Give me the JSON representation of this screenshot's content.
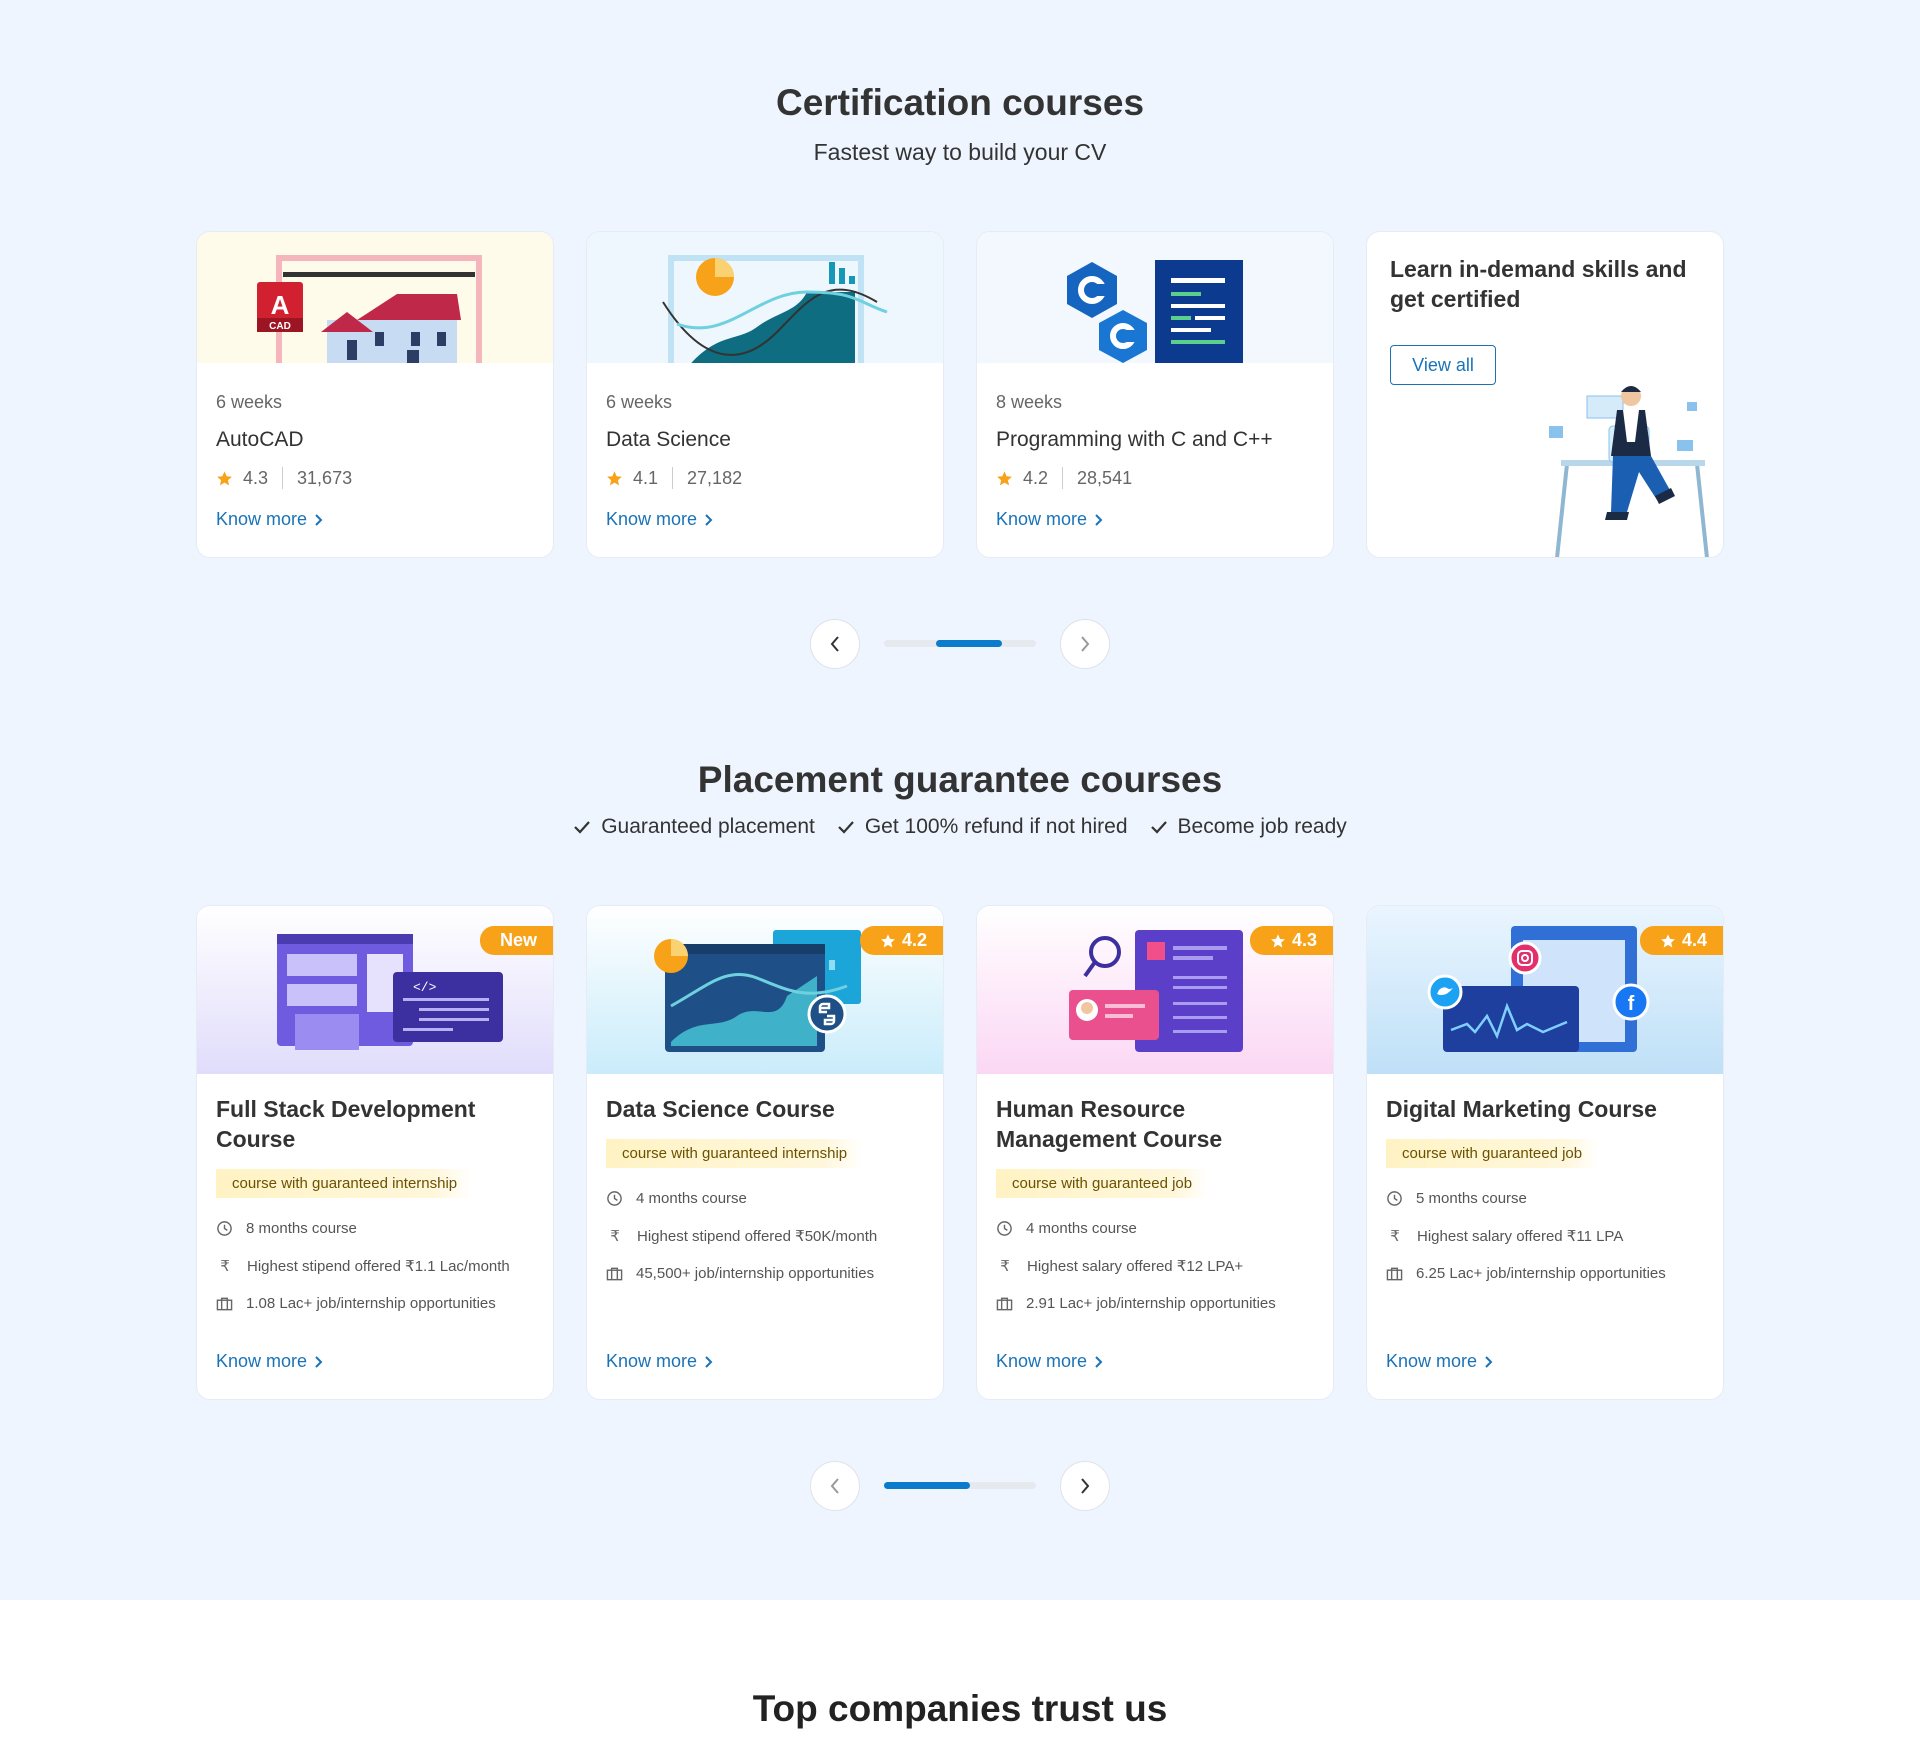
{
  "certification": {
    "title": "Certification courses",
    "subtitle": "Fastest way to build your CV",
    "cards": [
      {
        "duration": "6 weeks",
        "title": "AutoCAD",
        "rating": "4.3",
        "learners": "31,673",
        "link": "Know more",
        "icon_label": "A",
        "icon_sub": "CAD"
      },
      {
        "duration": "6 weeks",
        "title": "Data Science",
        "rating": "4.1",
        "learners": "27,182",
        "link": "Know more"
      },
      {
        "duration": "8 weeks",
        "title": "Programming with C and C++",
        "rating": "4.2",
        "learners": "28,541",
        "link": "Know more"
      }
    ],
    "promo": {
      "title": "Learn in-demand skills and get certified",
      "button": "View all"
    },
    "carousel_position": 0.6
  },
  "placement": {
    "title": "Placement guarantee courses",
    "checks": [
      "Guaranteed placement",
      "Get 100% refund if not hired",
      "Become job ready"
    ],
    "cards": [
      {
        "badge": "New",
        "title": "Full Stack Development Course",
        "tag": "course with guaranteed internship",
        "duration": "8 months course",
        "pay": "Highest stipend offered ₹1.1 Lac/month",
        "opportunities": "1.08 Lac+ job/internship opportunities",
        "link": "Know more"
      },
      {
        "badge": "4.2",
        "title": "Data Science Course",
        "tag": "course with guaranteed internship",
        "duration": "4 months course",
        "pay": "Highest stipend offered ₹50K/month",
        "opportunities": "45,500+ job/internship opportunities",
        "link": "Know more"
      },
      {
        "badge": "4.3",
        "title": "Human Resource Management Course",
        "tag": "course with guaranteed job",
        "duration": "4 months course",
        "pay": "Highest salary offered ₹12 LPA+",
        "opportunities": "2.91 Lac+ job/internship opportunities",
        "link": "Know more"
      },
      {
        "badge": "4.4",
        "title": "Digital Marketing Course",
        "tag": "course with guaranteed job",
        "duration": "5 months course",
        "pay": "Highest salary offered ₹11 LPA",
        "opportunities": "6.25 Lac+ job/internship opportunities",
        "link": "Know more"
      }
    ],
    "carousel_position": 0.0
  },
  "companies": {
    "title": "Top companies trust us"
  },
  "icons": {
    "star": "star-icon",
    "clock": "clock-icon",
    "rupee": "rupee-icon",
    "briefcase": "briefcase-icon",
    "check": "check-icon",
    "chevron_left": "chevron-left-icon",
    "chevron_right": "chevron-right-icon"
  },
  "colors": {
    "page_bg": "#eef5ff",
    "accent": "#1a73b8",
    "progress": "#0b7ccc",
    "badge": "#f7a219",
    "star": "#f7a219",
    "tag_bg": "#fff3c4"
  }
}
